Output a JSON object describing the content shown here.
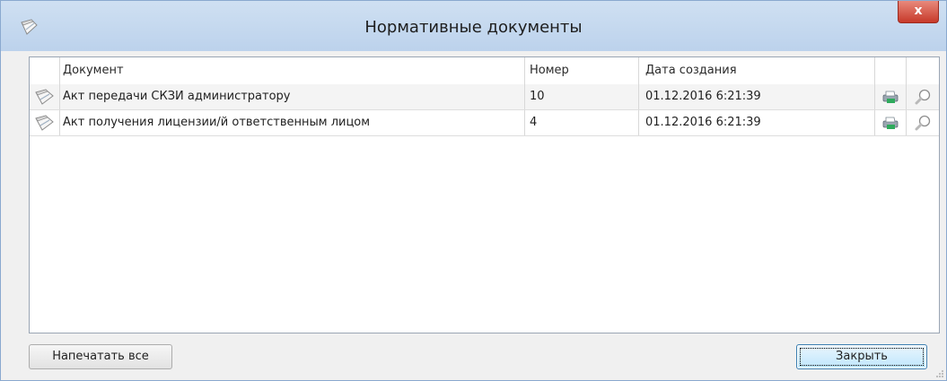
{
  "window": {
    "title": "Нормативные документы",
    "close_glyph": "x"
  },
  "grid": {
    "columns": [
      "Документ",
      "Номер",
      "Дата создания"
    ],
    "rows": [
      {
        "document": "Акт передачи СКЗИ администратору",
        "number": "10",
        "created": "01.12.2016 6:21:39",
        "icon": "document-icon",
        "actions": [
          "print-icon",
          "magnifier-icon"
        ]
      },
      {
        "document": "Акт получения лицензии/й ответственным лицом",
        "number": "4",
        "created": "01.12.2016 6:21:39",
        "icon": "document-icon",
        "actions": [
          "print-icon",
          "magnifier-icon"
        ]
      }
    ]
  },
  "buttons": {
    "print_all": "Напечатать все",
    "close": "Закрыть"
  },
  "colors": {
    "titlebar": "#c6daf0",
    "close_button": "#c7392a",
    "default_button_border": "#3c7fb1"
  }
}
